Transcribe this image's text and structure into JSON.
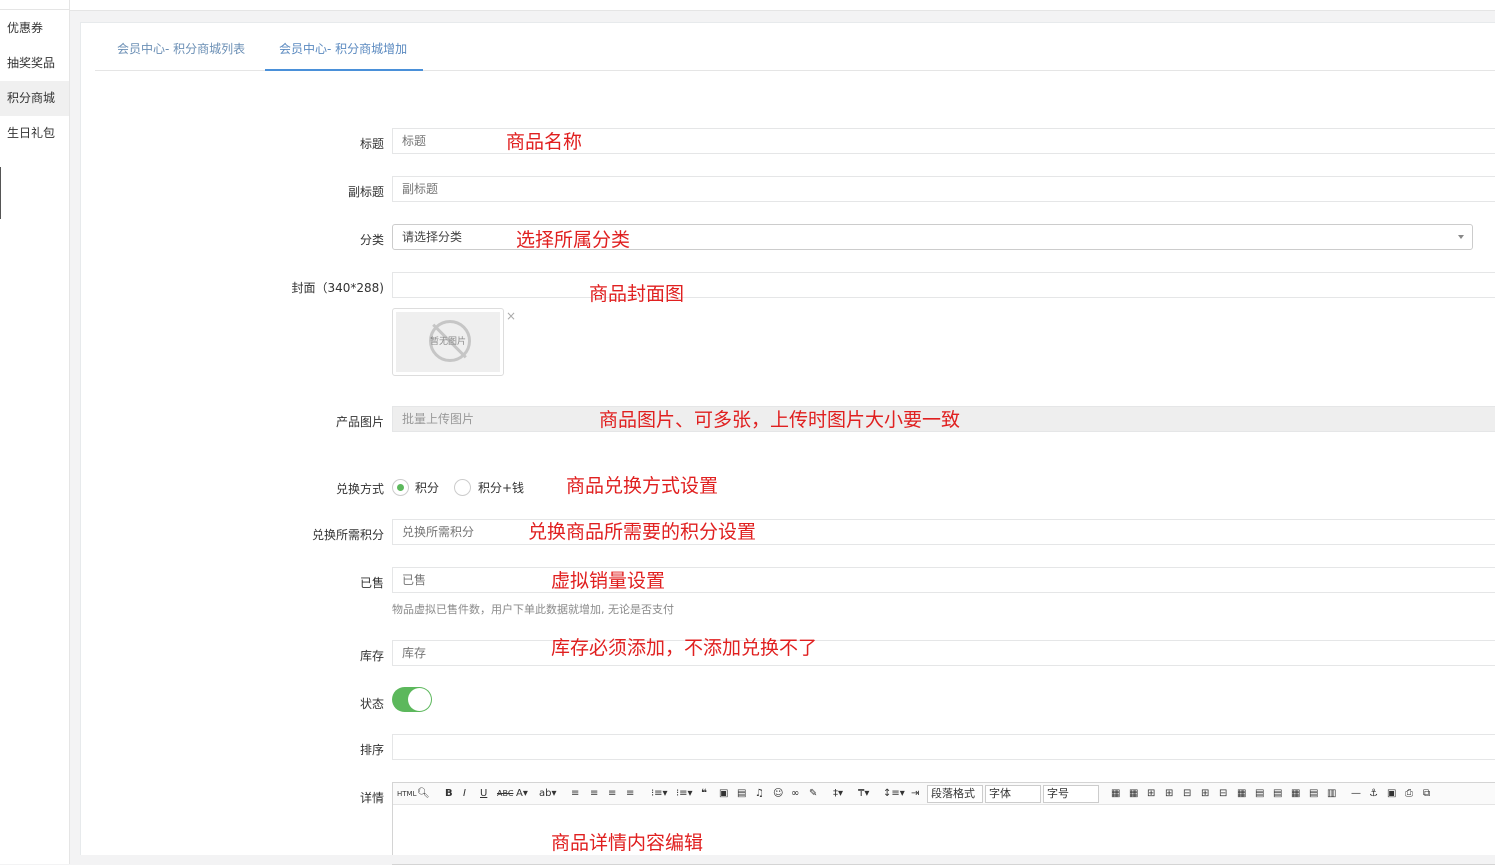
{
  "sidebar": {
    "items": [
      {
        "label": "优惠券"
      },
      {
        "label": "抽奖奖品"
      },
      {
        "label": "积分商城"
      },
      {
        "label": "生日礼包"
      }
    ]
  },
  "tabs": [
    {
      "label": "会员中心- 积分商城列表"
    },
    {
      "label": "会员中心- 积分商城增加"
    }
  ],
  "form": {
    "title_label": "标题",
    "title_placeholder": "标题",
    "subtitle_label": "副标题",
    "subtitle_placeholder": "副标题",
    "category_label": "分类",
    "category_value": "请选择分类",
    "cover_label": "封面（340*288)",
    "cover_empty_text": "暂无图片",
    "cover_remove": "×",
    "images_label": "产品图片",
    "images_button": "批量上传图片",
    "exchange_label": "兑换方式",
    "exchange_options": [
      {
        "label": "积分",
        "checked": true
      },
      {
        "label": "积分+钱",
        "checked": false
      }
    ],
    "points_label": "兑换所需积分",
    "points_placeholder": "兑换所需积分",
    "sold_label": "已售",
    "sold_placeholder": "已售",
    "sold_help": "物品虚拟已售件数，用户下单此数据就增加, 无论是否支付",
    "stock_label": "库存",
    "stock_placeholder": "库存",
    "status_label": "状态",
    "status_on": true,
    "sort_label": "排序",
    "sort_value": "",
    "detail_label": "详情"
  },
  "editor_toolbar": {
    "paragraph": "段落格式",
    "font": "字体",
    "size": "字号"
  },
  "annotations": {
    "title": "商品名称",
    "category": "选择所属分类",
    "cover": "商品封面图",
    "images": "商品图片、可多张，上传时图片大小要一致",
    "exchange": "商品兑换方式设置",
    "points": "兑换商品所需要的积分设置",
    "sold": "虚拟销量设置",
    "stock": "库存必须添加，不添加兑换不了",
    "detail": "商品详情内容编辑"
  },
  "colors": {
    "accent": "#4a90d9",
    "annotation": "#e02020",
    "toggle_on": "#5cb85c"
  }
}
